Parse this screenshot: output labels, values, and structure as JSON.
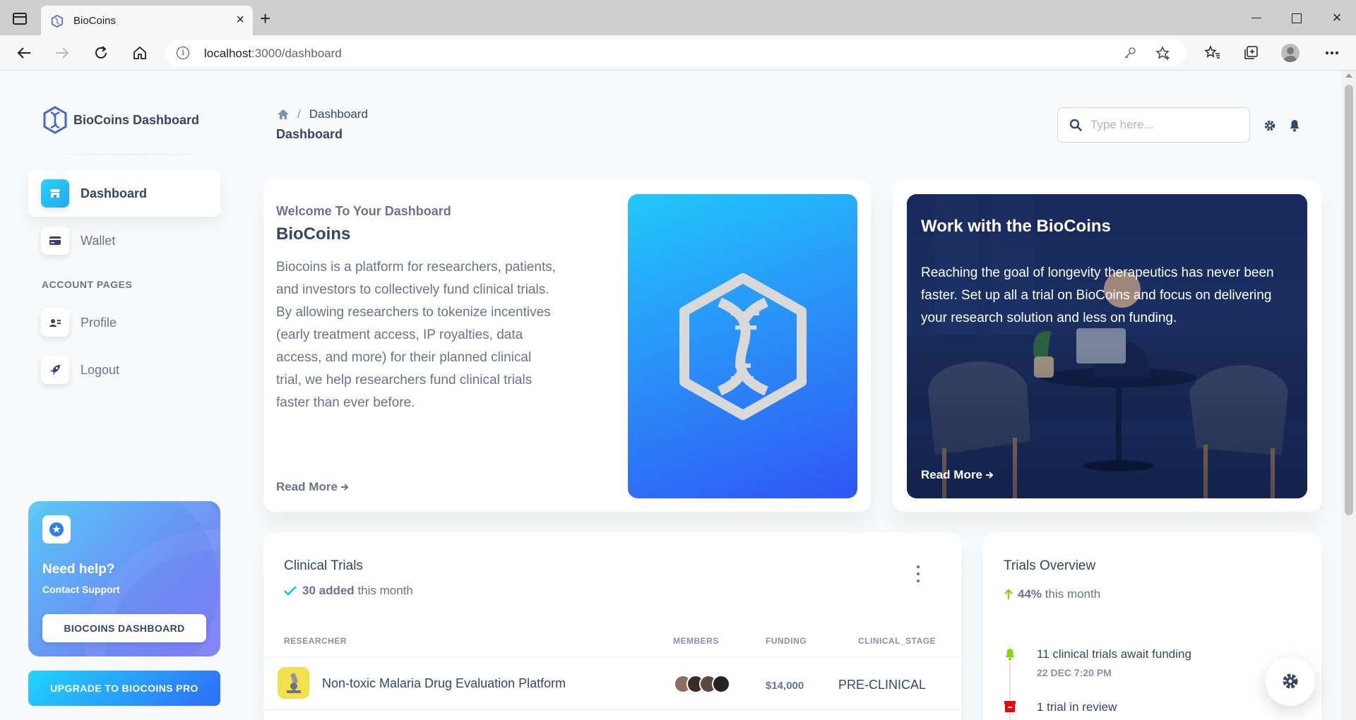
{
  "browser": {
    "tab_title": "BioCoins",
    "new_tab_symbol": "+",
    "close_symbol": "×",
    "address_host": "localhost",
    "address_path": ":3000/dashboard"
  },
  "sidebar": {
    "brand": "BioCoins Dashboard",
    "items": [
      {
        "label": "Dashboard",
        "icon": "shop-icon",
        "active": true
      },
      {
        "label": "Wallet",
        "icon": "credit-card-icon",
        "active": false
      }
    ],
    "section_title": "ACCOUNT PAGES",
    "account_items": [
      {
        "label": "Profile",
        "icon": "user-card-icon"
      },
      {
        "label": "Logout",
        "icon": "rocket-icon"
      }
    ],
    "help": {
      "title": "Need help?",
      "subtitle": "Contact Support",
      "button": "BIOCOINS DASHBOARD"
    },
    "upgrade_button": "UPGRADE TO BIOCOINS PRO"
  },
  "header": {
    "breadcrumb_current": "Dashboard",
    "breadcrumb_sep": "/",
    "page_title": "Dashboard",
    "search_placeholder": "Type here..."
  },
  "welcome": {
    "pre_title": "Welcome To Your Dashboard",
    "title": "BioCoins",
    "body": "Biocoins is a platform for researchers, patients, and investors to collectively fund clinical trials. By allowing researchers to tokenize incentives (early treatment access, IP royalties, data access, and more) for their planned clinical trial, we help researchers fund clinical trials faster than ever before.",
    "read_more": "Read More"
  },
  "work": {
    "title": "Work with the BioCoins",
    "body": "Reaching the goal of longevity therapeutics has never been faster. Set up all a trial on BioCoins and focus on delivering your research solution and less on funding.",
    "read_more": "Read More"
  },
  "trials": {
    "title": "Clinical Trials",
    "added_count": "30 added",
    "added_suffix": "this month",
    "columns": [
      "RESEARCHER",
      "MEMBERS",
      "FUNDING",
      "CLINICAL_STAGE"
    ],
    "rows": [
      {
        "name": "Non-toxic Malaria Drug Evaluation Platform",
        "funding": "$14,000",
        "stage": "PRE-CLINICAL"
      }
    ]
  },
  "overview": {
    "title": "Trials Overview",
    "percent": "44%",
    "percent_suffix": "this month",
    "events": [
      {
        "title": "11 clinical trials await funding",
        "date": "22 DEC 7:20 PM",
        "icon": "bell-icon",
        "color": "#82d616"
      },
      {
        "title": "1 trial in review",
        "date": "",
        "icon": "archive-icon",
        "color": "#ea0606"
      }
    ]
  },
  "colors": {
    "primary_text": "#344767",
    "secondary_text": "#67748e",
    "accent_cyan": "#21d4fd",
    "accent_blue": "#2f56f5",
    "success": "#82d616",
    "danger": "#ea0606"
  }
}
